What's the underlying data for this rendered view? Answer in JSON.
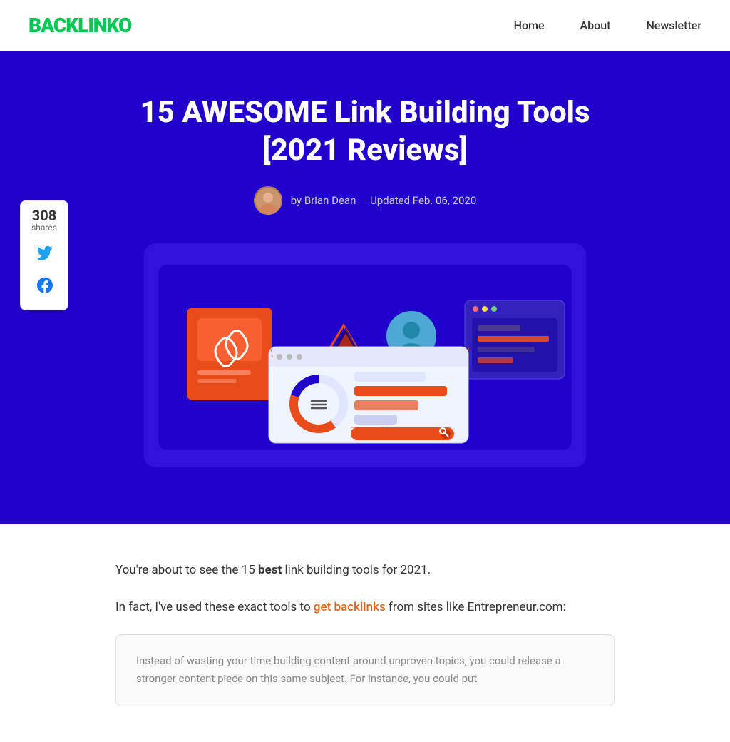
{
  "navbar": {
    "logo_text": "BACKLINK",
    "logo_o": "O",
    "nav_links": [
      {
        "label": "Home",
        "id": "home"
      },
      {
        "label": "About",
        "id": "about"
      },
      {
        "label": "Newsletter",
        "id": "newsletter"
      }
    ]
  },
  "share_widget": {
    "count": "308",
    "label": "shares",
    "twitter_icon": "🐦",
    "facebook_icon": "f"
  },
  "hero": {
    "title": "15 AWESOME Link Building Tools [2021 Reviews]",
    "author": "by Brian Dean",
    "updated": "· Updated Feb. 06, 2020"
  },
  "content": {
    "intro1_before": "You're about to see the 15 ",
    "intro1_bold": "best",
    "intro1_after": " link building tools for 2021.",
    "intro2_before": "In fact, I've used these exact tools to ",
    "intro2_link": "get backlinks",
    "intro2_after": " from sites like Entrepreneur.com:",
    "quote_text": "Instead of wasting your time building content around unproven topics, you could release a stronger content piece on this same subject. For instance, you could put"
  }
}
